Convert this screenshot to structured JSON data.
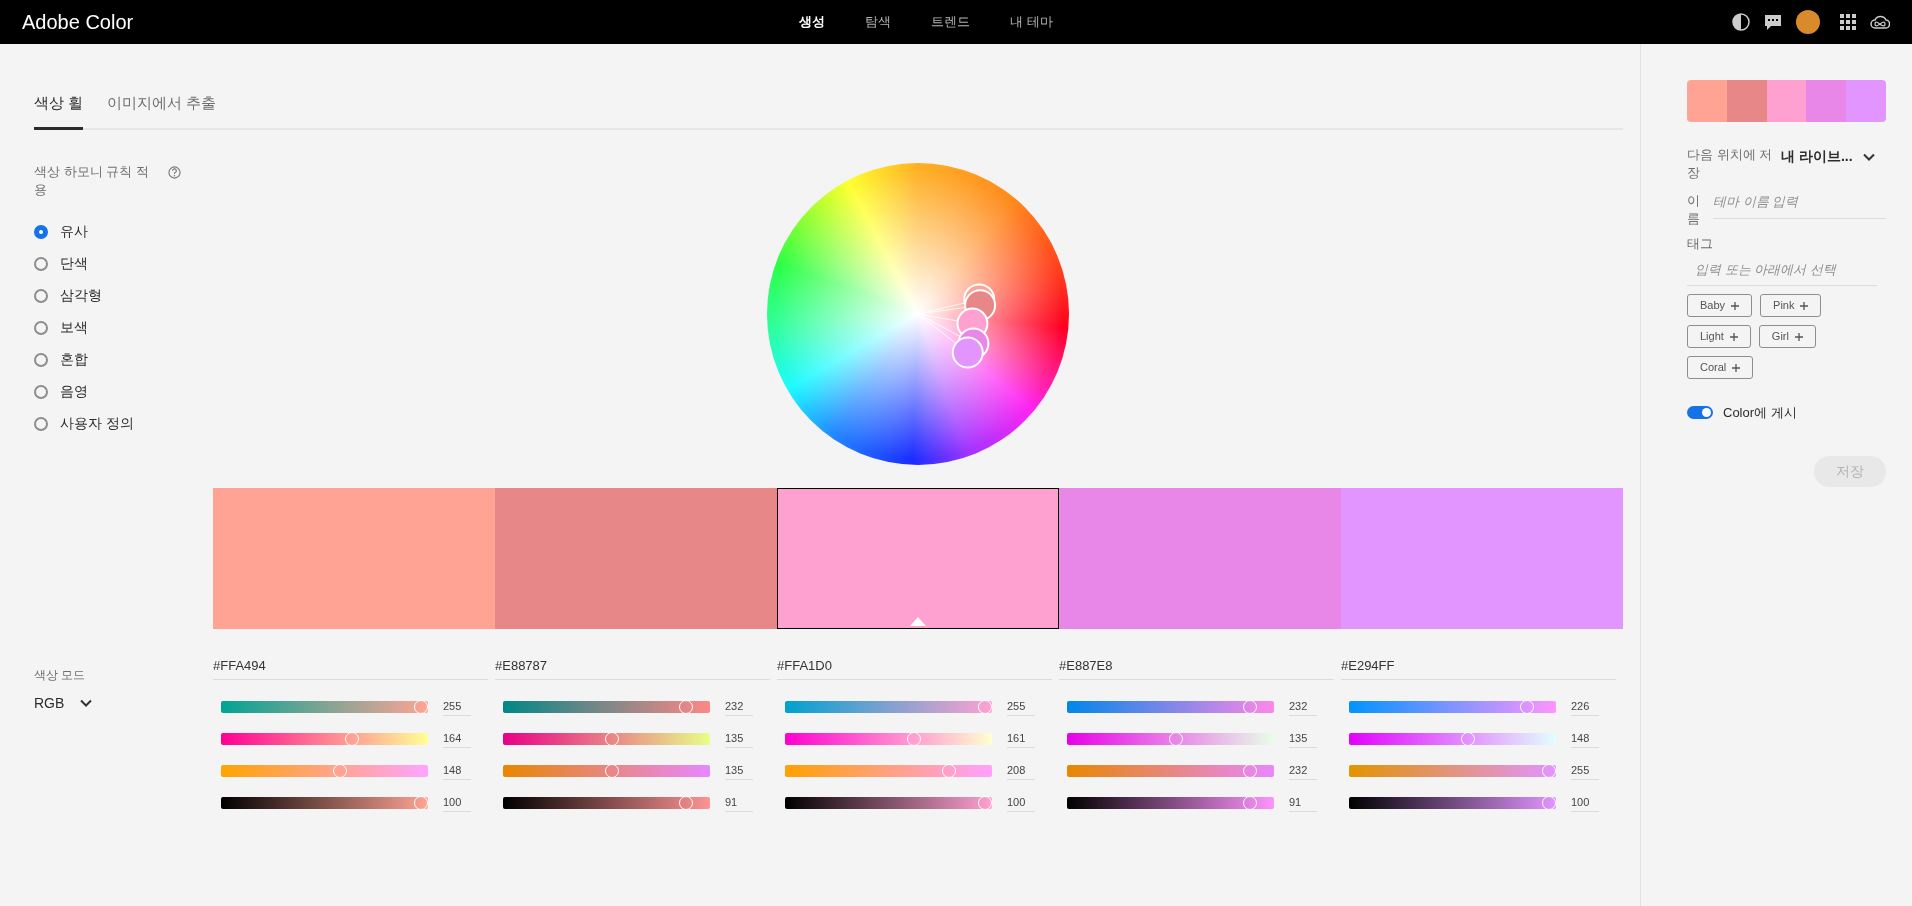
{
  "header": {
    "logo": "Adobe Color",
    "nav": [
      {
        "label": "생성",
        "selected": true
      },
      {
        "label": "탐색",
        "selected": false
      },
      {
        "label": "트렌드",
        "selected": false
      },
      {
        "label": "내 테마",
        "selected": false
      }
    ]
  },
  "tabs": [
    {
      "label": "색상 휠",
      "selected": true
    },
    {
      "label": "이미지에서 추출",
      "selected": false
    }
  ],
  "harmony": {
    "label": "색상 하모니 규칙 적용",
    "options": [
      {
        "label": "유사",
        "selected": true
      },
      {
        "label": "단색",
        "selected": false
      },
      {
        "label": "삼각형",
        "selected": false
      },
      {
        "label": "보색",
        "selected": false
      },
      {
        "label": "혼합",
        "selected": false
      },
      {
        "label": "음영",
        "selected": false
      },
      {
        "label": "사용자 정의",
        "selected": false
      }
    ]
  },
  "swatches": [
    {
      "color": "#ffa494",
      "selected": false,
      "hex": "#FFA494",
      "channels": [
        {
          "kind": "red",
          "value": "255",
          "level": 1
        },
        {
          "kind": "green",
          "value": "164",
          "level": 0.643
        },
        {
          "kind": "blue",
          "value": "148",
          "level": 0.58
        },
        {
          "kind": "brightness",
          "value": "100",
          "level": 1
        }
      ]
    },
    {
      "color": "#e88787",
      "selected": false,
      "hex": "#E88787",
      "channels": [
        {
          "kind": "red",
          "value": "232",
          "level": 0.91
        },
        {
          "kind": "green",
          "value": "135",
          "level": 0.529
        },
        {
          "kind": "blue",
          "value": "135",
          "level": 0.529
        },
        {
          "kind": "brightness",
          "value": "91",
          "level": 0.91
        }
      ]
    },
    {
      "color": "#ffa1d0",
      "selected": true,
      "hex": "#FFA1D0",
      "channels": [
        {
          "kind": "red",
          "value": "255",
          "level": 1
        },
        {
          "kind": "green",
          "value": "161",
          "level": 0.631
        },
        {
          "kind": "blue",
          "value": "208",
          "level": 0.816
        },
        {
          "kind": "brightness",
          "value": "100",
          "level": 1
        }
      ]
    },
    {
      "color": "#e887e8",
      "selected": false,
      "hex": "#E887E8",
      "channels": [
        {
          "kind": "red",
          "value": "232",
          "level": 0.91
        },
        {
          "kind": "green",
          "value": "135",
          "level": 0.529
        },
        {
          "kind": "blue",
          "value": "232",
          "level": 0.91
        },
        {
          "kind": "brightness",
          "value": "91",
          "level": 0.91
        }
      ]
    },
    {
      "color": "#e294ff",
      "selected": false,
      "hex": "#E294FF",
      "channels": [
        {
          "kind": "red",
          "value": "226",
          "level": 0.886
        },
        {
          "kind": "green",
          "value": "148",
          "level": 0.58
        },
        {
          "kind": "blue",
          "value": "255",
          "level": 1
        },
        {
          "kind": "brightness",
          "value": "100",
          "level": 1
        }
      ]
    }
  ],
  "color_mode": {
    "label": "색상 모드",
    "value": "RGB"
  },
  "panel": {
    "save_to_label": "다음 위치에 저장",
    "library": "내 라이브...",
    "name_label": "이름",
    "name_placeholder": "테마 이름 입력",
    "tags_label": "태그",
    "tags_placeholder": "입력 또는 아래에서 선택",
    "tags": [
      "Baby",
      "Pink",
      "Light",
      "Girl",
      "Coral"
    ],
    "publish": {
      "label": "Color에 게시",
      "on": true
    },
    "save": {
      "label": "저장",
      "disabled": true
    }
  }
}
